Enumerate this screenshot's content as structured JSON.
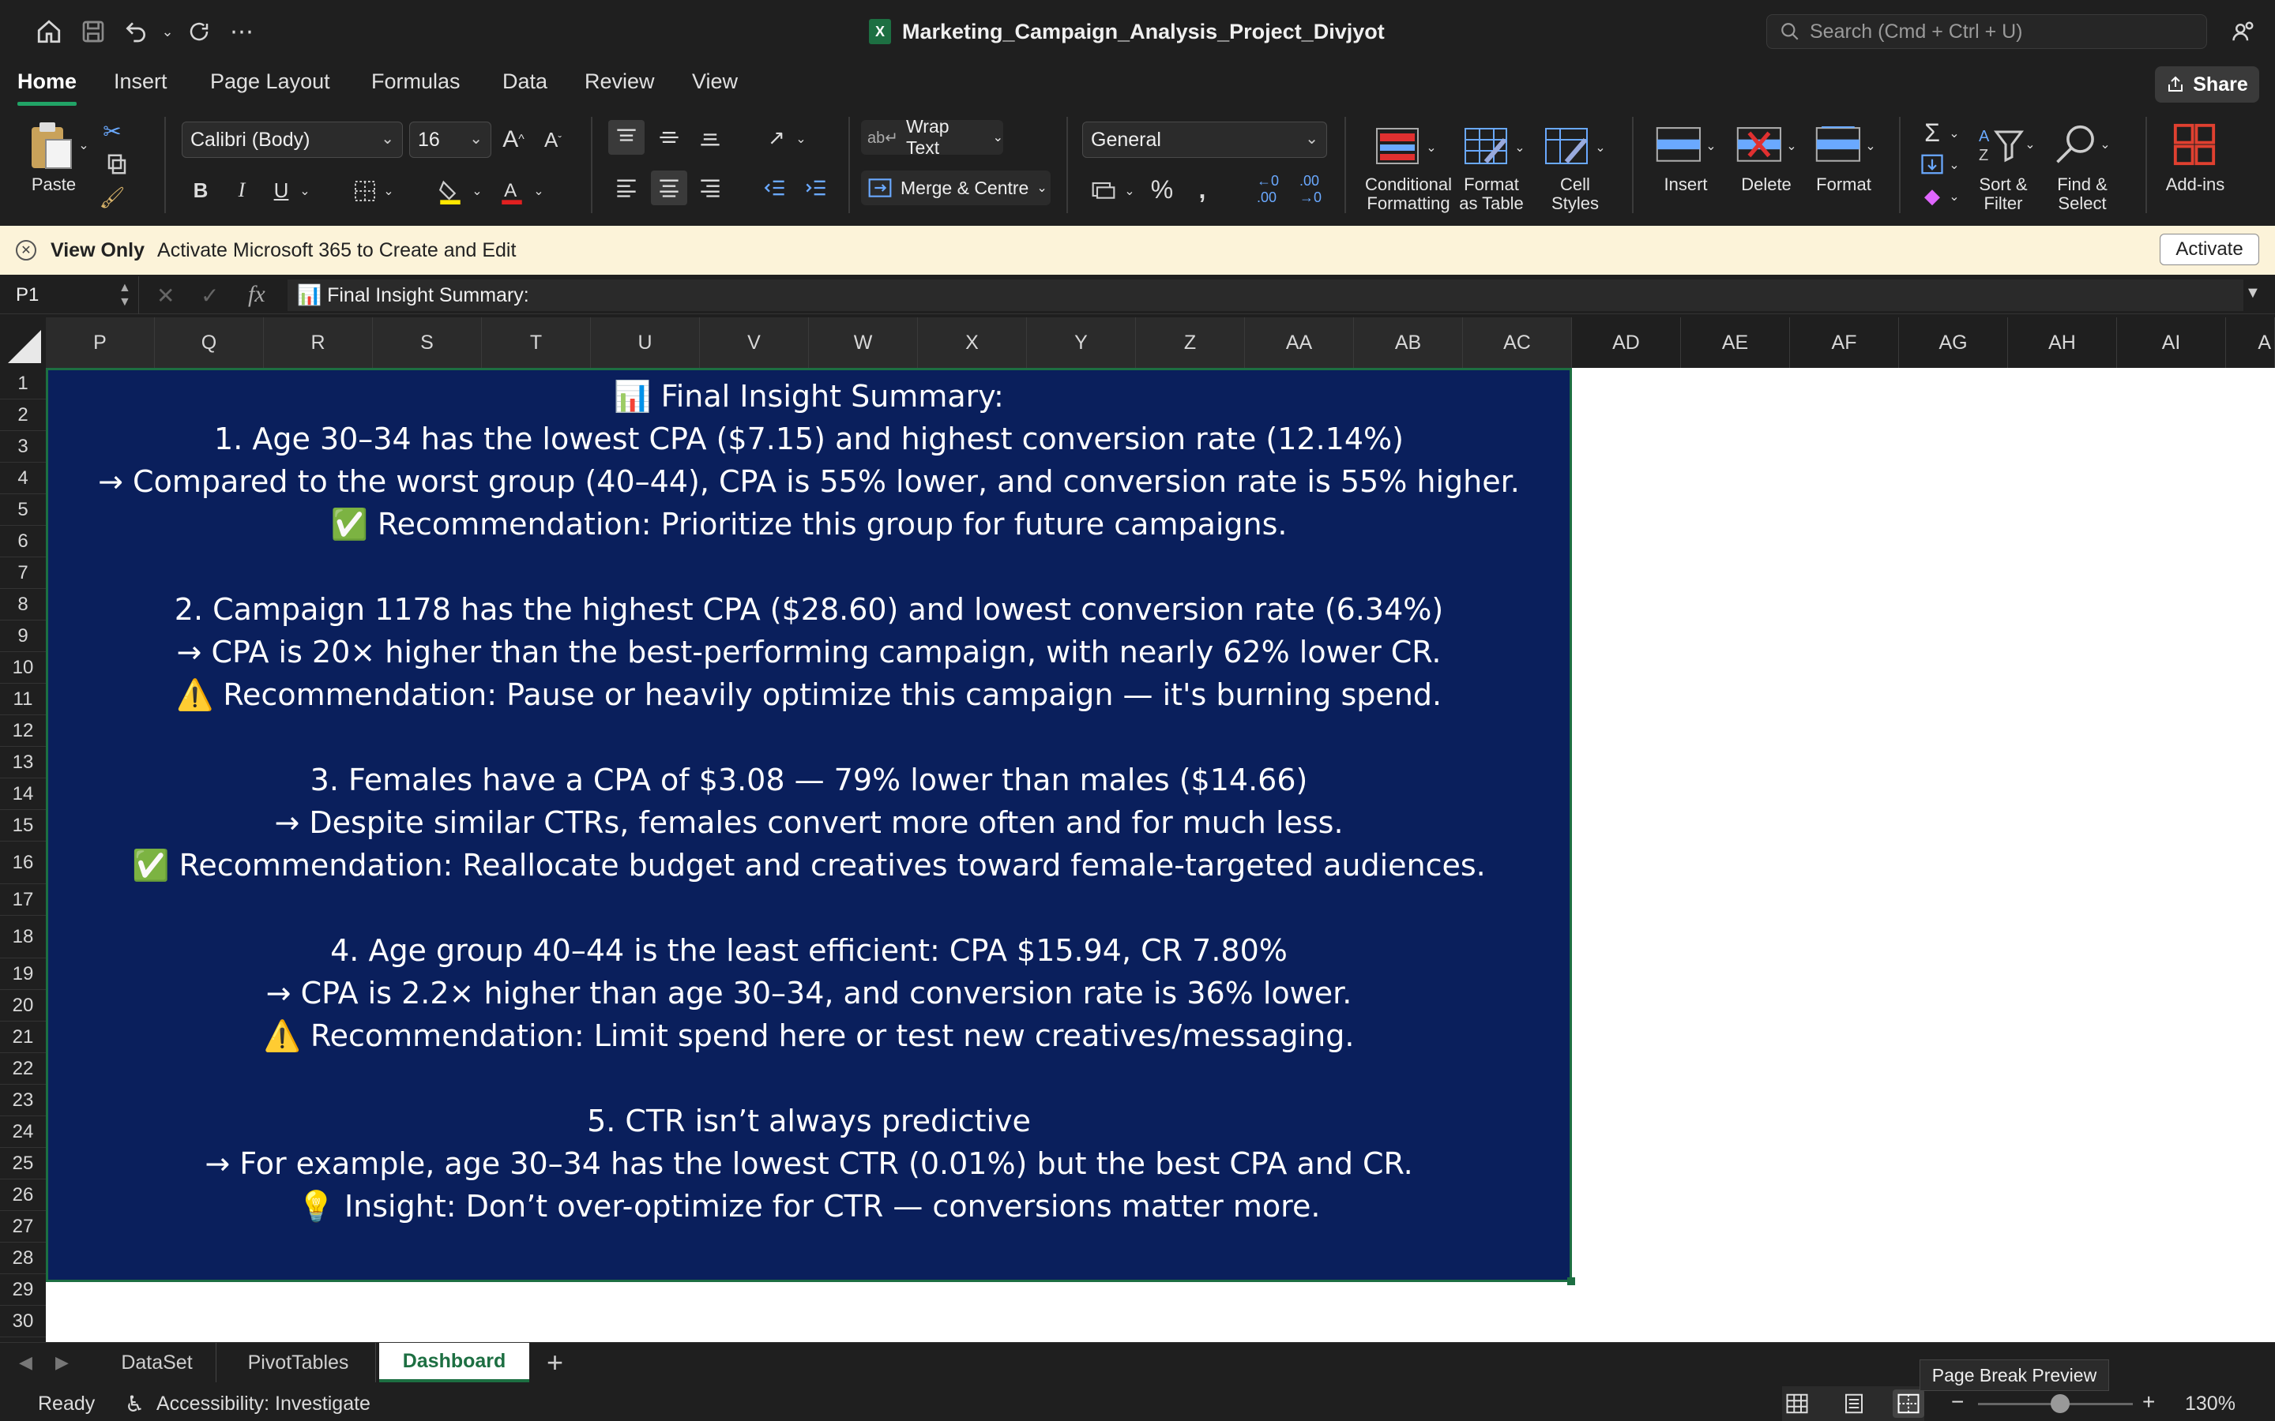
{
  "window": {
    "title": "Marketing_Campaign_Analysis_Project_Divjyot",
    "search_placeholder": "Search (Cmd + Ctrl + U)"
  },
  "ribbon_tabs": [
    "Home",
    "Insert",
    "Page Layout",
    "Formulas",
    "Data",
    "Review",
    "View"
  ],
  "share_label": "Share",
  "ribbon": {
    "paste": "Paste",
    "font_name": "Calibri (Body)",
    "font_size": "16",
    "wrap_text": "Wrap Text",
    "merge_centre": "Merge & Centre",
    "number_format": "General",
    "conditional_formatting": [
      "Conditional",
      "Formatting"
    ],
    "format_as_table": [
      "Format",
      "as Table"
    ],
    "cell_styles": [
      "Cell",
      "Styles"
    ],
    "insert": "Insert",
    "delete": "Delete",
    "format": "Format",
    "sort_filter": [
      "Sort &",
      "Filter"
    ],
    "find_select": [
      "Find &",
      "Select"
    ],
    "add_ins": "Add-ins"
  },
  "infobar": {
    "title": "View Only",
    "message": "Activate Microsoft 365 to Create and Edit",
    "button": "Activate"
  },
  "formula_bar": {
    "cell_ref": "P1",
    "content": "Final Insight Summary:"
  },
  "columns": [
    "P",
    "Q",
    "R",
    "S",
    "T",
    "U",
    "V",
    "W",
    "X",
    "Y",
    "Z",
    "AA",
    "AB",
    "AC",
    "AD",
    "AE",
    "AF",
    "AG",
    "AH",
    "AI",
    "A"
  ],
  "rows": [
    "1",
    "2",
    "3",
    "4",
    "5",
    "6",
    "7",
    "8",
    "9",
    "10",
    "11",
    "12",
    "13",
    "14",
    "15",
    "16",
    "17",
    "18",
    "19",
    "20",
    "21",
    "22",
    "23",
    "24",
    "25",
    "26",
    "27",
    "28",
    "29",
    "30"
  ],
  "summary_lines": [
    "📊 Final Insight Summary:",
    "1. Age 30–34 has the lowest CPA ($7.15) and highest conversion rate (12.14%)",
    "→ Compared to the worst group (40–44), CPA is 55% lower, and conversion rate is 55% higher.",
    "✅ Recommendation: Prioritize this group for future campaigns.",
    "",
    "2. Campaign 1178 has the highest CPA ($28.60) and lowest conversion rate (6.34%)",
    "→ CPA is 20× higher than the best-performing campaign, with nearly 62% lower CR.",
    "⚠️ Recommendation: Pause or heavily optimize this campaign — it's burning spend.",
    "",
    "3. Females have a CPA of $3.08 — 79% lower than males ($14.66)",
    "→ Despite similar CTRs, females convert more often and for much less.",
    "✅ Recommendation: Reallocate budget and creatives toward female-targeted audiences.",
    "",
    "4. Age group 40–44 is the least efficient: CPA $15.94, CR 7.80%",
    "→ CPA is 2.2× higher than age 30–34, and conversion rate is 36% lower.",
    "⚠️ Recommendation: Limit spend here or test new creatives/messaging.",
    "",
    "5. CTR isn’t always predictive",
    "→ For example, age 30–34 has the lowest CTR (0.01%) but the best CPA and CR.",
    "💡 Insight: Don’t over-optimize for CTR — conversions matter more."
  ],
  "sheet_tabs": [
    "DataSet",
    "PivotTables",
    "Dashboard"
  ],
  "active_sheet": "Dashboard",
  "status": {
    "ready": "Ready",
    "accessibility": "Accessibility: Investigate",
    "tooltip": "Page Break Preview",
    "zoom": "130%"
  },
  "colors": {
    "merged_fill": "#0a1f5c",
    "excel_green": "#1d6f42",
    "infobar_bg": "#fcf3d9"
  }
}
